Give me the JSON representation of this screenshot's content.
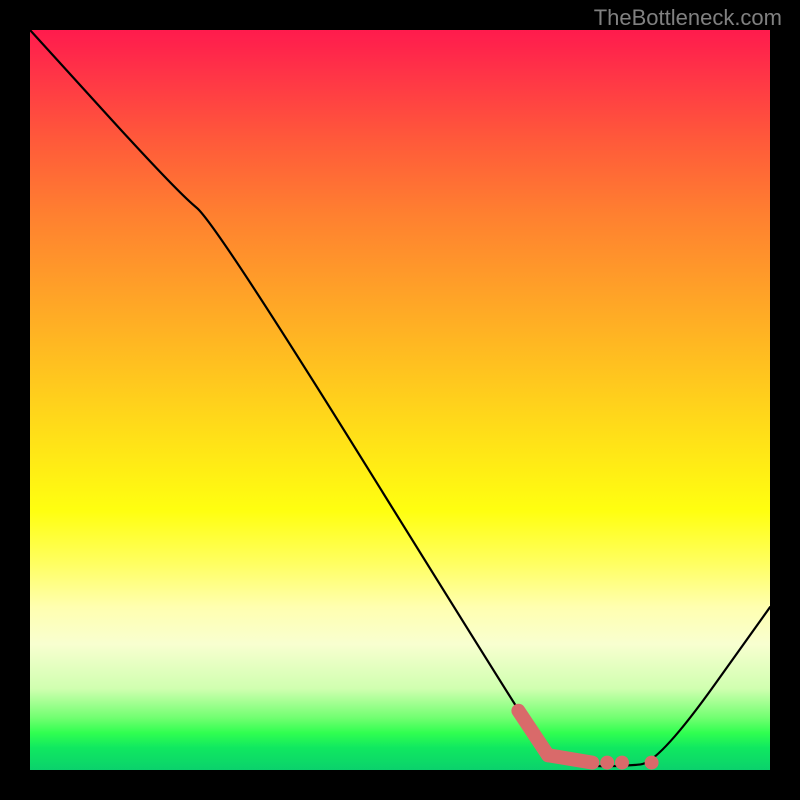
{
  "watermark": "TheBottleneck.com",
  "chart_data": {
    "type": "line",
    "title": "",
    "xlabel": "",
    "ylabel": "",
    "xlim": [
      0,
      100
    ],
    "ylim": [
      0,
      100
    ],
    "series": [
      {
        "name": "curve",
        "x": [
          0,
          20,
          25,
          66,
          70,
          75,
          80,
          85,
          100
        ],
        "values": [
          100,
          78,
          74,
          8,
          2,
          0.5,
          0.5,
          1,
          22
        ]
      }
    ],
    "markers": [
      {
        "name": "segment",
        "x_start": 66,
        "x_end": 70,
        "y_start": 8,
        "y_end": 2
      },
      {
        "name": "segment",
        "x_start": 70,
        "x_end": 76,
        "y_start": 2,
        "y_end": 1
      },
      {
        "name": "dot",
        "x": 78,
        "y": 1
      },
      {
        "name": "dot",
        "x": 80,
        "y": 1
      },
      {
        "name": "dot",
        "x": 84,
        "y": 1
      }
    ],
    "gradient_stops": [
      {
        "pct": 0,
        "color": "#ff1b4d"
      },
      {
        "pct": 15,
        "color": "#ff5a3a"
      },
      {
        "pct": 35,
        "color": "#ffa028"
      },
      {
        "pct": 55,
        "color": "#ffe018"
      },
      {
        "pct": 72,
        "color": "#ffff60"
      },
      {
        "pct": 89,
        "color": "#d0ffb0"
      },
      {
        "pct": 97,
        "color": "#10e860"
      },
      {
        "pct": 100,
        "color": "#0bd16c"
      }
    ],
    "marker_color": "#d96a6a"
  }
}
